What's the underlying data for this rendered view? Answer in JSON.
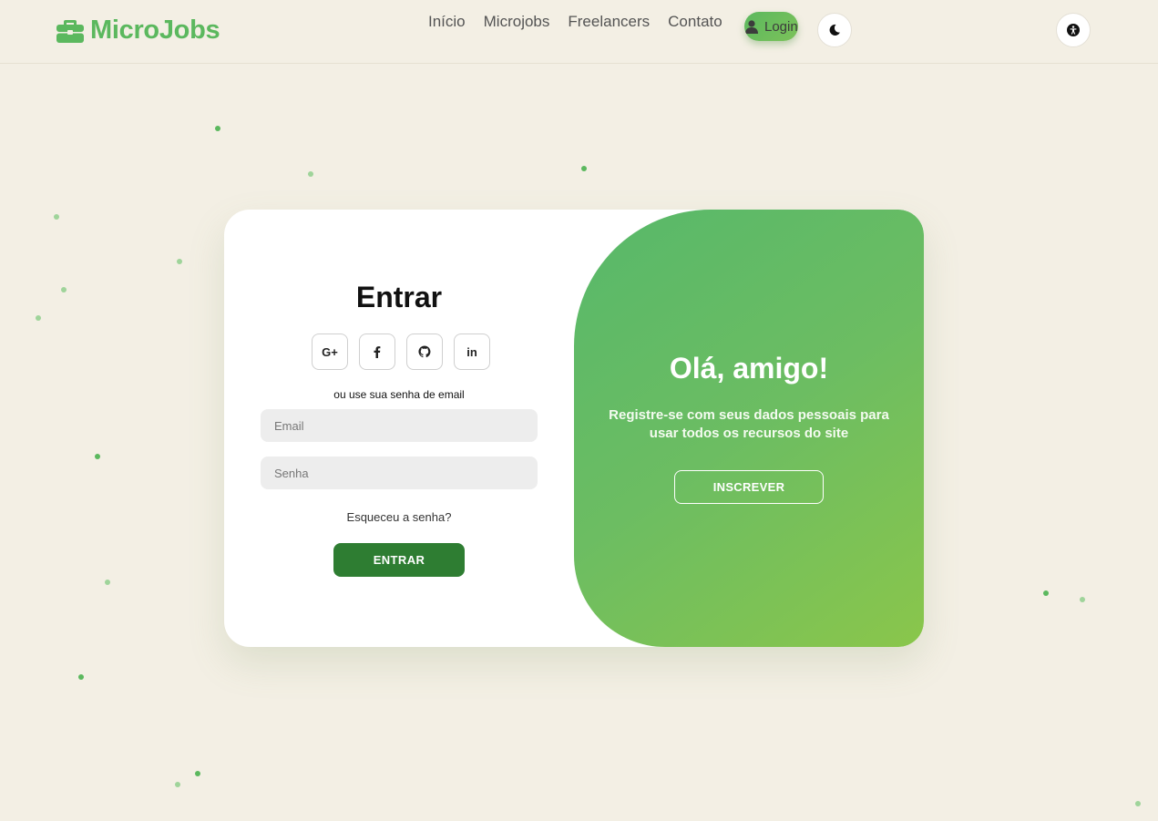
{
  "header": {
    "brand": "MicroJobs",
    "nav": [
      "Início",
      "Microjobs",
      "Freelancers",
      "Contato"
    ],
    "login_label": "Login"
  },
  "login": {
    "title": "Entrar",
    "social": {
      "google": "G+",
      "linkedin": "in"
    },
    "alt_text": "ou use sua senha de email",
    "email_placeholder": "Email",
    "password_placeholder": "Senha",
    "forgot": "Esqueceu a senha?",
    "submit": "ENTRAR"
  },
  "welcome": {
    "title": "Olá, amigo!",
    "text": "Registre-se com seus dados pessoais para usar todos os recursos do site",
    "button": "INSCREVER"
  },
  "colors": {
    "brand": "#5bb85e",
    "primary_button": "#2e7d32",
    "background": "#f3efe4"
  }
}
